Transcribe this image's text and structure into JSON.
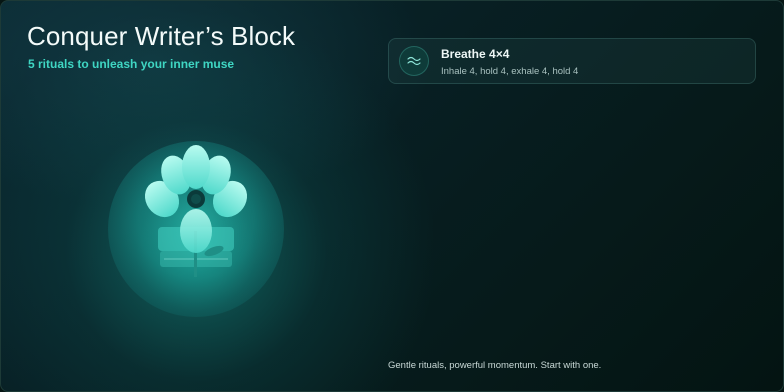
{
  "header": {
    "title": "Conquer Writer’s Block",
    "subtitle": "5 rituals to unleash your inner muse"
  },
  "ritual": {
    "icon": "breath-waves-icon",
    "title": "Breathe 4×4",
    "description": "Inhale 4, hold 4, exhale 4, hold 4"
  },
  "illustration": {
    "icon": "flower-bloom-illustration"
  },
  "footer": {
    "note": "Gentle rituals, powerful momentum. Start with one."
  },
  "colors": {
    "accent": "#3fd6c3",
    "background": "#061614",
    "glow": "#22d2be"
  }
}
